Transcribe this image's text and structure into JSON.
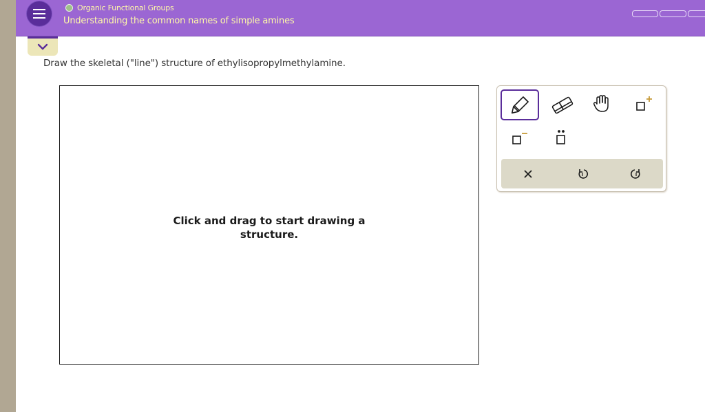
{
  "header": {
    "topic": "Organic Functional Groups",
    "subtitle": "Understanding the common names of simple amines",
    "progress_segments": 3
  },
  "question": {
    "text": "Draw the skeletal (\"line\") structure of ethylisopropylmethylamine."
  },
  "canvas": {
    "hint": "Click and drag to start drawing a structure."
  },
  "toolbar": {
    "tools": [
      "pencil-icon",
      "eraser-icon",
      "hand-icon",
      "add-charge-icon",
      "remove-charge-icon",
      "lone-pair-icon"
    ],
    "active_tool": "pencil-icon",
    "actions": [
      "clear-icon",
      "undo-icon",
      "redo-icon"
    ]
  },
  "colors": {
    "header_bg": "#9b66d3",
    "header_text": "#fff9a8",
    "menu_button": "#5a2d9a",
    "collapse_tab": "#ece6b8",
    "action_bar": "#dcd9c8",
    "charge_accent": "#c79b3a"
  }
}
